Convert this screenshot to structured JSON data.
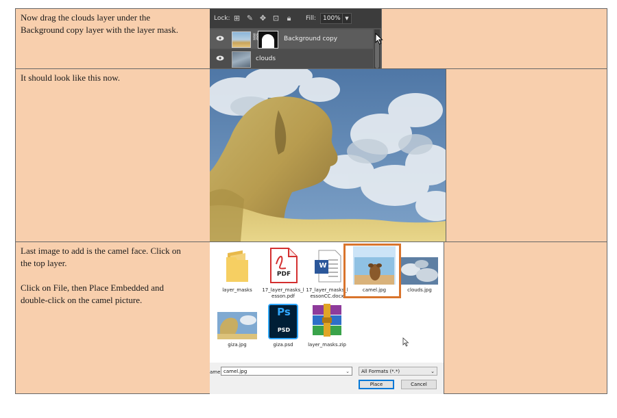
{
  "rows": [
    {
      "lines": [
        "Now drag the clouds layer under the",
        "Background copy layer with the layer mask."
      ]
    },
    {
      "lines": [
        "It should look like this now."
      ]
    },
    {
      "lines": [
        "Last image to add is the camel face. Click on",
        "the top layer.",
        "",
        "Click on File, then Place Embedded and",
        "double-click on the camel picture."
      ]
    }
  ],
  "layers_panel": {
    "lock_label": "Lock:",
    "fill_label": "Fill:",
    "fill_value": "100%",
    "layers": [
      {
        "name": "Background copy",
        "has_mask": true
      },
      {
        "name": "clouds",
        "has_mask": false
      }
    ]
  },
  "file_dialog": {
    "files": [
      {
        "name": "layer_masks",
        "type": "folder-icon"
      },
      {
        "name": "17_layer_masks_l\nesson.pdf",
        "type": "pdf-icon"
      },
      {
        "name": "17_layer_masks_l\nessonCC.docx",
        "type": "word-icon"
      },
      {
        "name": "camel.jpg",
        "type": "image-thumb",
        "selected": true
      },
      {
        "name": "clouds.jpg",
        "type": "image-thumb"
      },
      {
        "name": "giza.jpg",
        "type": "image-thumb"
      },
      {
        "name": "giza.psd",
        "type": "psd-icon"
      },
      {
        "name": "layer_masks.zip",
        "type": "zip-icon"
      }
    ],
    "pdf_badge": "PDF",
    "word_badge": "W",
    "psd_badge_top": "Ps",
    "psd_badge_bottom": "PSD",
    "filename_label": "ame:",
    "filename_value": "camel.jpg",
    "format_value": "All Formats (*.*)",
    "place_button": "Place",
    "cancel_button": "Cancel"
  },
  "colors": {
    "cell_bg": "#f8cfad",
    "selection_border": "#d9742c",
    "ps_panel": "#535353"
  }
}
